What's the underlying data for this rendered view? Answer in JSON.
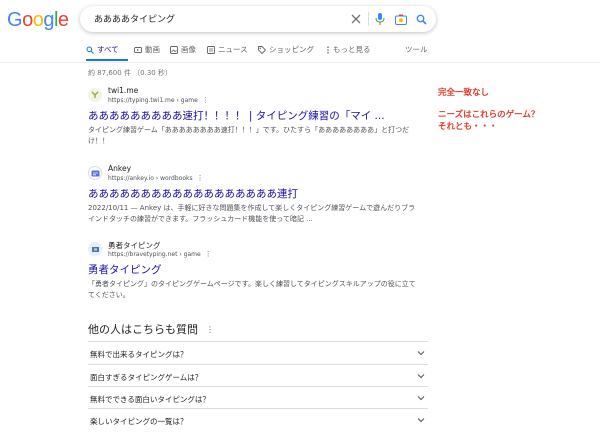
{
  "logo": {
    "letters": [
      "G",
      "o",
      "o",
      "g",
      "l",
      "e"
    ],
    "colors": [
      "#4285f4",
      "#ea4335",
      "#fbbc05",
      "#4285f4",
      "#34a853",
      "#ea4335"
    ]
  },
  "search": {
    "query": "ああああタイピング"
  },
  "tabs": [
    {
      "label": "すべて",
      "icon": "search-icon"
    },
    {
      "label": "動画",
      "icon": "video-icon"
    },
    {
      "label": "画像",
      "icon": "image-icon"
    },
    {
      "label": "ニュース",
      "icon": "news-icon"
    },
    {
      "label": "ショッピング",
      "icon": "tag-icon"
    },
    {
      "label": "もっと見る",
      "icon": "more-vert-icon"
    }
  ],
  "tools_label": "ツール",
  "stats": "約 87,600 件 （0.30 秒）",
  "results": [
    {
      "site": "twi1.me",
      "url": "https://typing.twi1.me › game",
      "title": "あああああああああ速打！！！！ | タイピング練習の「マイ ...",
      "snippet": "タイピング練習ゲーム「ああああああああ速打！！！」です。ひたすら「ああああああああ」と打つだけ！！"
    },
    {
      "site": "Ankey",
      "url": "https://ankey.io › wordbooks",
      "title": "ああああああああああああああああああ連打",
      "snippet": "2022/10/11 — Ankey は、手軽に好きな問題集を作成して楽しくタイピング練習ゲームで遊んだりブラインドタッチの練習ができます。フラッシュカード機能を使って暗記 ..."
    },
    {
      "site": "勇者タイピング",
      "url": "https://bravetyping.net › game",
      "title": "勇者タイピング",
      "snippet": "「勇者タイピング」のタイピングゲームページです。楽しく練習してタイピングスキルアップの役に立ててください。"
    }
  ],
  "notes": [
    "完全一致なし",
    "ニーズはこれらのゲーム？",
    "それとも・・・"
  ],
  "paa": {
    "heading": "他の人はこちらも質問",
    "questions": [
      "無料で出来るタイピングは？",
      "面白すぎるタイピングゲームは？",
      "無料でできる面白いタイピングは？",
      "楽しいタイピングの一覧は？"
    ]
  }
}
